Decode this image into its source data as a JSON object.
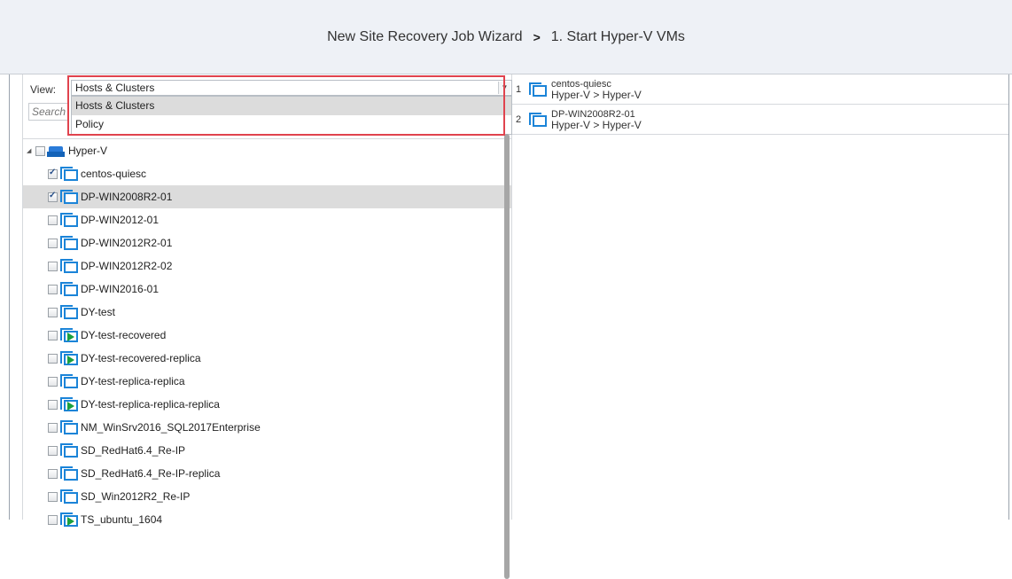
{
  "header": {
    "wizard_title": "New Site Recovery Job Wizard",
    "separator": ">",
    "step": "1. Start Hyper-V VMs"
  },
  "inventory": {
    "view_label": "View:",
    "view_value": "Hosts & Clusters",
    "search_placeholder": "Search",
    "dropdown_options": [
      "Hosts & Clusters",
      "Policy"
    ],
    "root": {
      "label": "Hyper-V",
      "checked": false
    },
    "vms": [
      {
        "label": "centos-quiesc",
        "checked": true,
        "running": false
      },
      {
        "label": "DP-WIN2008R2-01",
        "checked": true,
        "running": false,
        "selected": true
      },
      {
        "label": "DP-WIN2012-01",
        "checked": false,
        "running": false
      },
      {
        "label": "DP-WIN2012R2-01",
        "checked": false,
        "running": false
      },
      {
        "label": "DP-WIN2012R2-02",
        "checked": false,
        "running": false
      },
      {
        "label": "DP-WIN2016-01",
        "checked": false,
        "running": false
      },
      {
        "label": "DY-test",
        "checked": false,
        "running": false
      },
      {
        "label": "DY-test-recovered",
        "checked": false,
        "running": true
      },
      {
        "label": "DY-test-recovered-replica",
        "checked": false,
        "running": true
      },
      {
        "label": "DY-test-replica-replica",
        "checked": false,
        "running": false
      },
      {
        "label": "DY-test-replica-replica-replica",
        "checked": false,
        "running": true
      },
      {
        "label": "NM_WinSrv2016_SQL2017Enterprise",
        "checked": false,
        "running": false
      },
      {
        "label": "SD_RedHat6.4_Re-IP",
        "checked": false,
        "running": false
      },
      {
        "label": "SD_RedHat6.4_Re-IP-replica",
        "checked": false,
        "running": false
      },
      {
        "label": "SD_Win2012R2_Re-IP",
        "checked": false,
        "running": false
      },
      {
        "label": "TS_ubuntu_1604",
        "checked": false,
        "running": true
      }
    ]
  },
  "selected_vms": [
    {
      "number": "1",
      "name": "centos-quiesc",
      "path": "Hyper-V > Hyper-V"
    },
    {
      "number": "2",
      "name": "DP-WIN2008R2-01",
      "path": "Hyper-V > Hyper-V"
    }
  ],
  "colors": {
    "highlight": "#e0434e",
    "vm_icon": "#1b84d8",
    "running": "#1aa03e",
    "header_bg": "#eef1f6"
  }
}
